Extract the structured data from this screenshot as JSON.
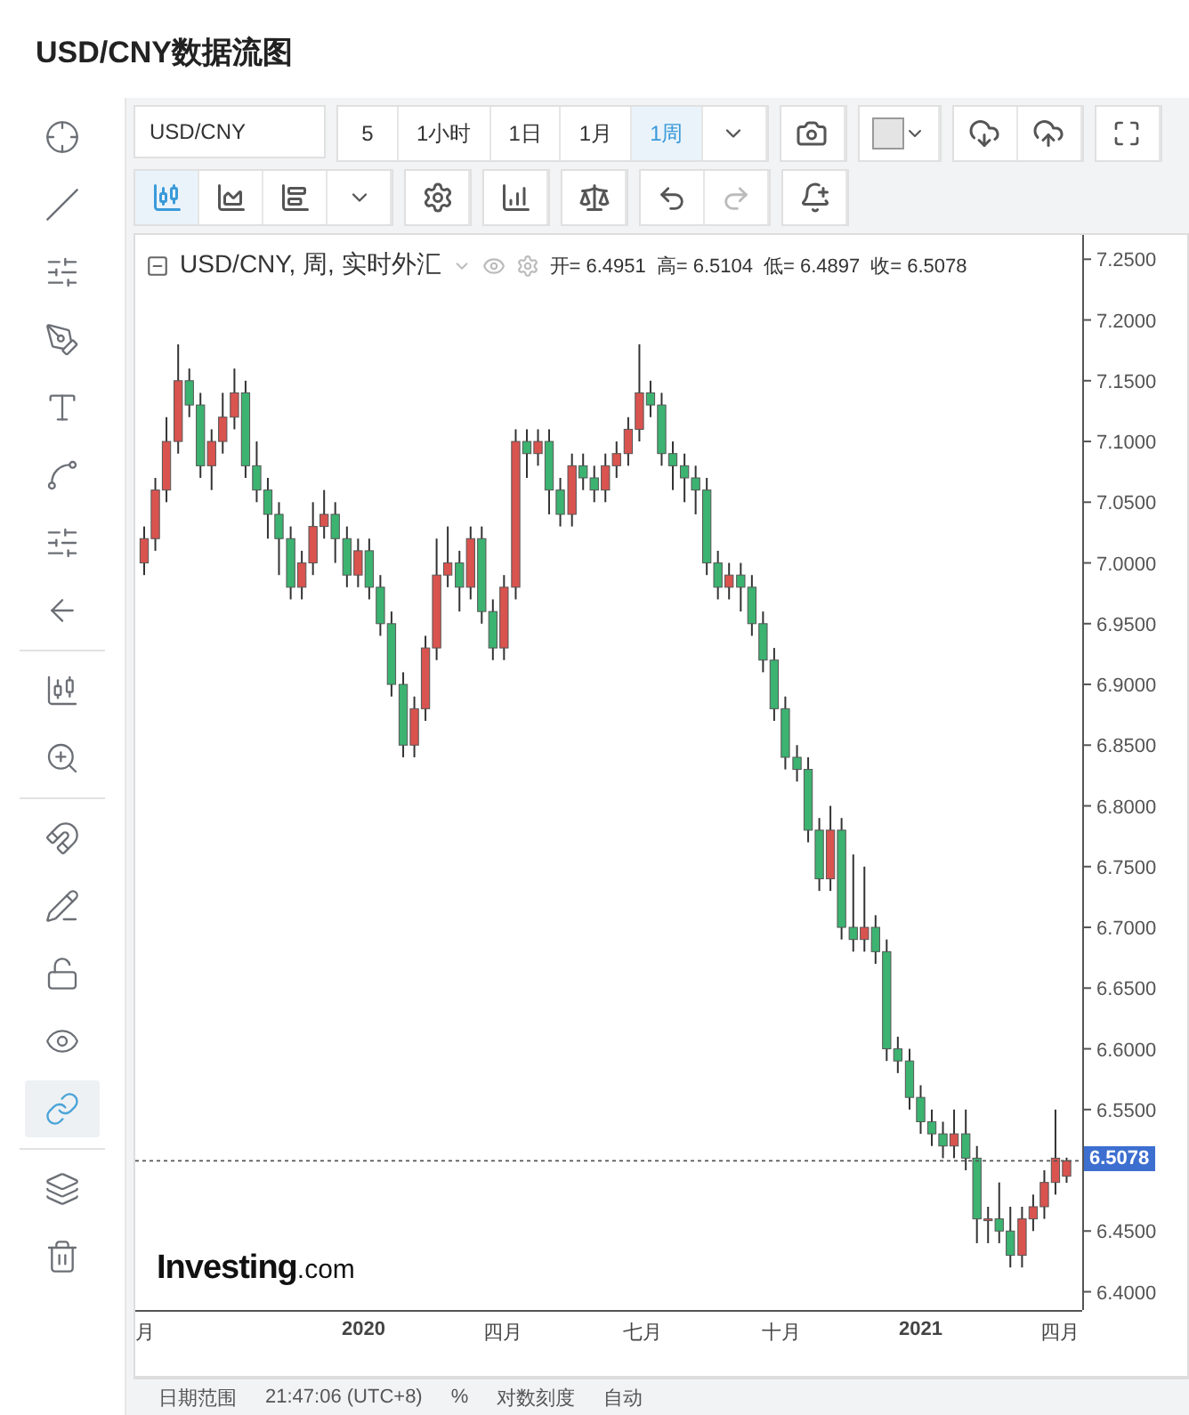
{
  "page_title": "USD/CNY数据流图",
  "toolbar": {
    "symbol": "USD/CNY",
    "intervals": [
      {
        "label": "5",
        "selected": false
      },
      {
        "label": "1小时",
        "selected": false
      },
      {
        "label": "1日",
        "selected": false
      },
      {
        "label": "1月",
        "selected": false
      },
      {
        "label": "1周",
        "selected": true
      }
    ]
  },
  "chart_types": [
    {
      "kind": "candles",
      "selected": true
    },
    {
      "kind": "area",
      "selected": false
    },
    {
      "kind": "bars",
      "selected": false
    }
  ],
  "left_tools": [
    {
      "kind": "crosshair",
      "selected": false
    },
    {
      "kind": "line",
      "selected": false
    },
    {
      "kind": "fib",
      "selected": false
    },
    {
      "kind": "brush",
      "selected": false
    },
    {
      "kind": "text",
      "selected": false
    },
    {
      "kind": "pattern",
      "selected": false
    },
    {
      "kind": "measure",
      "selected": false
    },
    {
      "kind": "back",
      "selected": false
    },
    {
      "kind": "ruler",
      "selected": false
    },
    {
      "kind": "zoom",
      "selected": false
    },
    {
      "kind": "magnet",
      "selected": false
    },
    {
      "kind": "lockpen",
      "selected": false
    },
    {
      "kind": "lock",
      "selected": false
    },
    {
      "kind": "eye",
      "selected": false
    },
    {
      "kind": "link",
      "selected": true
    },
    {
      "kind": "layers",
      "selected": false
    },
    {
      "kind": "trash",
      "selected": false
    }
  ],
  "chart": {
    "legend_title": "USD/CNY, 周, 实时外汇",
    "ohlc": [
      {
        "label": "开=",
        "value": "6.4951"
      },
      {
        "label": "高=",
        "value": "6.5104"
      },
      {
        "label": "低=",
        "value": "6.4897"
      },
      {
        "label": "收=",
        "value": "6.5078"
      }
    ],
    "chart_data": {
      "type": "candlestick",
      "x": [
        2019.606,
        2019.626,
        2019.646,
        2019.667,
        2019.687,
        2019.707,
        2019.727,
        2019.747,
        2019.768,
        2019.788,
        2019.808,
        2019.828,
        2019.848,
        2019.869,
        2019.889,
        2019.909,
        2019.929,
        2019.949,
        2019.97,
        2019.99,
        2020.01,
        2020.03,
        2020.05,
        2020.071,
        2020.091,
        2020.111,
        2020.131,
        2020.151,
        2020.172,
        2020.192,
        2020.212,
        2020.232,
        2020.252,
        2020.273,
        2020.293,
        2020.313,
        2020.333,
        2020.353,
        2020.374,
        2020.394,
        2020.414,
        2020.434,
        2020.454,
        2020.475,
        2020.495,
        2020.515,
        2020.535,
        2020.555,
        2020.576,
        2020.596,
        2020.616,
        2020.636,
        2020.656,
        2020.677,
        2020.697,
        2020.717,
        2020.737,
        2020.757,
        2020.778,
        2020.798,
        2020.818,
        2020.838,
        2020.858,
        2020.879,
        2020.899,
        2020.919,
        2020.939,
        2020.959,
        2020.98,
        2021.0,
        2021.02,
        2021.04,
        2021.06,
        2021.081,
        2021.101,
        2021.121,
        2021.141,
        2021.161,
        2021.182,
        2021.202,
        2021.222,
        2021.242,
        2021.262
      ],
      "ohlc": [
        [
          7.0,
          7.03,
          6.99,
          7.02
        ],
        [
          7.02,
          7.07,
          7.01,
          7.06
        ],
        [
          7.06,
          7.12,
          7.05,
          7.1
        ],
        [
          7.1,
          7.18,
          7.09,
          7.15
        ],
        [
          7.15,
          7.16,
          7.12,
          7.13
        ],
        [
          7.13,
          7.14,
          7.07,
          7.08
        ],
        [
          7.08,
          7.11,
          7.06,
          7.1
        ],
        [
          7.1,
          7.14,
          7.09,
          7.12
        ],
        [
          7.12,
          7.16,
          7.11,
          7.14
        ],
        [
          7.14,
          7.15,
          7.07,
          7.08
        ],
        [
          7.08,
          7.1,
          7.05,
          7.06
        ],
        [
          7.06,
          7.07,
          7.02,
          7.04
        ],
        [
          7.04,
          7.05,
          6.99,
          7.02
        ],
        [
          7.02,
          7.03,
          6.97,
          6.98
        ],
        [
          6.98,
          7.01,
          6.97,
          7.0
        ],
        [
          7.0,
          7.05,
          6.99,
          7.03
        ],
        [
          7.03,
          7.06,
          7.02,
          7.04
        ],
        [
          7.04,
          7.05,
          7.0,
          7.02
        ],
        [
          7.02,
          7.03,
          6.98,
          6.99
        ],
        [
          6.99,
          7.02,
          6.98,
          7.01
        ],
        [
          7.01,
          7.02,
          6.97,
          6.98
        ],
        [
          6.98,
          6.99,
          6.94,
          6.95
        ],
        [
          6.95,
          6.96,
          6.89,
          6.9
        ],
        [
          6.9,
          6.91,
          6.84,
          6.85
        ],
        [
          6.85,
          6.89,
          6.84,
          6.88
        ],
        [
          6.88,
          6.94,
          6.87,
          6.93
        ],
        [
          6.93,
          7.02,
          6.92,
          6.99
        ],
        [
          6.99,
          7.03,
          6.98,
          7.0
        ],
        [
          7.0,
          7.01,
          6.96,
          6.98
        ],
        [
          6.98,
          7.03,
          6.97,
          7.02
        ],
        [
          7.02,
          7.03,
          6.95,
          6.96
        ],
        [
          6.96,
          6.97,
          6.92,
          6.93
        ],
        [
          6.93,
          6.99,
          6.92,
          6.98
        ],
        [
          6.98,
          7.11,
          6.97,
          7.1
        ],
        [
          7.1,
          7.11,
          7.07,
          7.09
        ],
        [
          7.09,
          7.11,
          7.08,
          7.1
        ],
        [
          7.1,
          7.11,
          7.04,
          7.06
        ],
        [
          7.06,
          7.07,
          7.03,
          7.04
        ],
        [
          7.04,
          7.09,
          7.03,
          7.08
        ],
        [
          7.08,
          7.09,
          7.06,
          7.07
        ],
        [
          7.07,
          7.08,
          7.05,
          7.06
        ],
        [
          7.06,
          7.09,
          7.05,
          7.08
        ],
        [
          7.08,
          7.1,
          7.07,
          7.09
        ],
        [
          7.09,
          7.12,
          7.08,
          7.11
        ],
        [
          7.11,
          7.18,
          7.1,
          7.14
        ],
        [
          7.14,
          7.15,
          7.12,
          7.13
        ],
        [
          7.13,
          7.14,
          7.08,
          7.09
        ],
        [
          7.09,
          7.1,
          7.06,
          7.08
        ],
        [
          7.08,
          7.09,
          7.05,
          7.07
        ],
        [
          7.07,
          7.08,
          7.04,
          7.06
        ],
        [
          7.06,
          7.07,
          6.99,
          7.0
        ],
        [
          7.0,
          7.01,
          6.97,
          6.98
        ],
        [
          6.98,
          7.0,
          6.97,
          6.99
        ],
        [
          6.99,
          7.0,
          6.96,
          6.98
        ],
        [
          6.98,
          6.99,
          6.94,
          6.95
        ],
        [
          6.95,
          6.96,
          6.91,
          6.92
        ],
        [
          6.92,
          6.93,
          6.87,
          6.88
        ],
        [
          6.88,
          6.89,
          6.83,
          6.84
        ],
        [
          6.84,
          6.85,
          6.82,
          6.83
        ],
        [
          6.83,
          6.84,
          6.77,
          6.78
        ],
        [
          6.78,
          6.79,
          6.73,
          6.74
        ],
        [
          6.74,
          6.8,
          6.73,
          6.78
        ],
        [
          6.78,
          6.79,
          6.69,
          6.7
        ],
        [
          6.7,
          6.76,
          6.68,
          6.69
        ],
        [
          6.69,
          6.75,
          6.68,
          6.7
        ],
        [
          6.7,
          6.71,
          6.67,
          6.68
        ],
        [
          6.68,
          6.69,
          6.59,
          6.6
        ],
        [
          6.6,
          6.61,
          6.58,
          6.59
        ],
        [
          6.59,
          6.6,
          6.55,
          6.56
        ],
        [
          6.56,
          6.57,
          6.53,
          6.54
        ],
        [
          6.54,
          6.55,
          6.52,
          6.53
        ],
        [
          6.53,
          6.54,
          6.51,
          6.52
        ],
        [
          6.52,
          6.55,
          6.51,
          6.53
        ],
        [
          6.53,
          6.55,
          6.5,
          6.51
        ],
        [
          6.51,
          6.52,
          6.44,
          6.46
        ],
        [
          6.46,
          6.47,
          6.44,
          6.46
        ],
        [
          6.46,
          6.49,
          6.44,
          6.45
        ],
        [
          6.45,
          6.47,
          6.42,
          6.43
        ],
        [
          6.43,
          6.47,
          6.42,
          6.46
        ],
        [
          6.46,
          6.48,
          6.45,
          6.47
        ],
        [
          6.47,
          6.5,
          6.46,
          6.49
        ],
        [
          6.49,
          6.55,
          6.48,
          6.51
        ],
        [
          6.4951,
          6.5104,
          6.4897,
          6.5078
        ]
      ],
      "xlim": [
        2019.59,
        2021.29
      ],
      "ref_lines": [
        {
          "axis": "y",
          "value": 6.5078
        }
      ],
      "ylim": [
        6.385,
        7.27
      ],
      "yticks": [
        {
          "value": 7.25,
          "label": "7.2500"
        },
        {
          "value": 7.2,
          "label": "7.2000"
        },
        {
          "value": 7.15,
          "label": "7.1500"
        },
        {
          "value": 7.1,
          "label": "7.1000"
        },
        {
          "value": 7.05,
          "label": "7.0500"
        },
        {
          "value": 7.0,
          "label": "7.0000"
        },
        {
          "value": 6.95,
          "label": "6.9500"
        },
        {
          "value": 6.9,
          "label": "6.9000"
        },
        {
          "value": 6.85,
          "label": "6.8500"
        },
        {
          "value": 6.8,
          "label": "6.8000"
        },
        {
          "value": 6.75,
          "label": "6.7500"
        },
        {
          "value": 6.7,
          "label": "6.7000"
        },
        {
          "value": 6.65,
          "label": "6.6500"
        },
        {
          "value": 6.6,
          "label": "6.6000"
        },
        {
          "value": 6.55,
          "label": "6.5500"
        },
        {
          "value": 6.45,
          "label": "6.4500"
        },
        {
          "value": 6.4,
          "label": "6.4000"
        }
      ],
      "xticks": [
        {
          "value": 2019.608,
          "label": "月"
        },
        {
          "value": 2020,
          "label": "2020"
        },
        {
          "value": 2020.25,
          "label": "四月"
        },
        {
          "value": 2020.5,
          "label": "七月"
        },
        {
          "value": 2020.75,
          "label": "十月"
        },
        {
          "value": 2021,
          "label": "2021"
        },
        {
          "value": 2021.25,
          "label": "四月"
        }
      ]
    },
    "last_price": "6.5078",
    "logo_text": "Investing",
    "logo_suffix": ".com"
  },
  "bottom_bar": [
    "日期范围",
    "21:47:06 (UTC+8)",
    "%",
    "对数刻度",
    "自动"
  ]
}
